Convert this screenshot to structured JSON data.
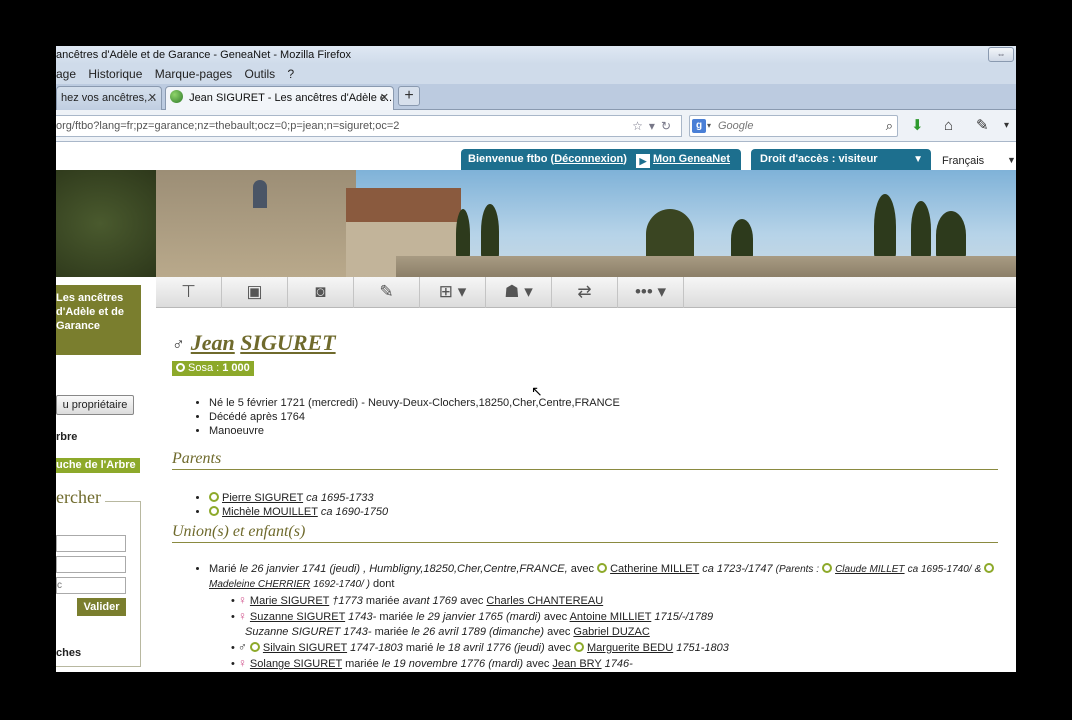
{
  "window": {
    "title": "ancêtres d'Adèle et de Garance - GeneaNet - Mozilla Firefox",
    "restore_icon": "⇔"
  },
  "menu": {
    "items": [
      "age",
      "Historique",
      "Marque-pages",
      "Outils",
      "?"
    ]
  },
  "tabs": [
    {
      "label": "hez vos ancêtres,..."
    },
    {
      "label": "Jean SIGURET - Les ancêtres d'Adèle e..."
    }
  ],
  "navbar": {
    "url": "org/ftbo?lang=fr;pz=garance;nz=thebault;ocz=0;p=jean;n=siguret;oc=2",
    "search_placeholder": "Google"
  },
  "header": {
    "welcome": "Bienvenue ftbo",
    "logout": "Déconnexion",
    "my_geneanet": "Mon GeneaNet",
    "access_label": "Droit d'accès :",
    "access_value": "visiteur",
    "language": "Français"
  },
  "sidebar": {
    "site_name": "Les ancêtres d'Adèle et de Garance",
    "owner_button": "u propriétaire",
    "arbre": "rbre",
    "souche": "uche de l'Arbre",
    "search_title": "ercher",
    "field3_placeholder": "c",
    "validate": "Valider",
    "ches": "ches"
  },
  "toolbar": {
    "icons": [
      "tree-icon",
      "id-card-icon",
      "camera-icon",
      "notes-icon",
      "descendants-icon",
      "relatives-icon",
      "swap-trees-icon",
      "more-icon"
    ]
  },
  "person": {
    "sex_symbol": "♂",
    "first_name": "Jean",
    "last_name": "SIGURET",
    "sosa_label": "Sosa :",
    "sosa_value": "1 000",
    "facts": [
      "Né le 5 février 1721 (mercredi) - Neuvy-Deux-Clochers,18250,Cher,Centre,FRANCE",
      "Décédé après 1764",
      "Manoeuvre"
    ]
  },
  "sections": {
    "parents": "Parents",
    "unions": "Union(s) et enfant(s)"
  },
  "parents": [
    {
      "name": "Pierre SIGURET",
      "dates": "ca 1695-1733"
    },
    {
      "name": "Michèle MOUILLET",
      "dates": "ca 1690-1750"
    }
  ],
  "union": {
    "marie": "Marié",
    "date": "le 26 janvier 1741 (jeudi) , Humbligny,18250,Cher,Centre,FRANCE,",
    "avec": "avec",
    "spouse": "Catherine MILLET",
    "spouse_dates": "ca 1723-/1747",
    "parents_label": "(Parents :",
    "father": "Claude MILLET",
    "father_dates": "ca 1695-1740/",
    "amp": "&",
    "mother": "Madeleine CHERRIER",
    "mother_dates": "1692-1740/ )",
    "dont": "dont"
  },
  "children": [
    {
      "sex": "♀",
      "name": "Marie SIGURET",
      "dates": "†1773",
      "text": "mariée",
      "marriage": "avant 1769",
      "avec": "avec",
      "spouse": "Charles CHANTEREAU",
      "spouse_dates": ""
    },
    {
      "sex": "♀",
      "name": "Suzanne SIGURET",
      "dates": "1743-",
      "text": "mariée",
      "marriage": "le 29 janvier 1765 (mardi)",
      "avec": "avec",
      "spouse": "Antoine MILLIET",
      "spouse_dates": "1715/-/1789"
    },
    {
      "sex": "",
      "name": "Suzanne SIGURET 1743-",
      "dates": "",
      "text": "mariée",
      "marriage": "le 26 avril 1789 (dimanche)",
      "avec": "avec",
      "spouse": "Gabriel DUZAC",
      "spouse_dates": ""
    },
    {
      "sex": "♂",
      "name": "Silvain SIGURET",
      "dates": "1747-1803",
      "text": "marié",
      "marriage": "le 18 avril 1776 (jeudi)",
      "avec": "avec",
      "spouse": "Marguerite BEDU",
      "spouse_dates": "1751-1803"
    },
    {
      "sex": "♀",
      "name": "Solange SIGURET",
      "dates": "",
      "text": "mariée",
      "marriage": "le 19 novembre 1776 (mardi)",
      "avec": "avec",
      "spouse": "Jean BRY",
      "spouse_dates": "1746-"
    }
  ]
}
